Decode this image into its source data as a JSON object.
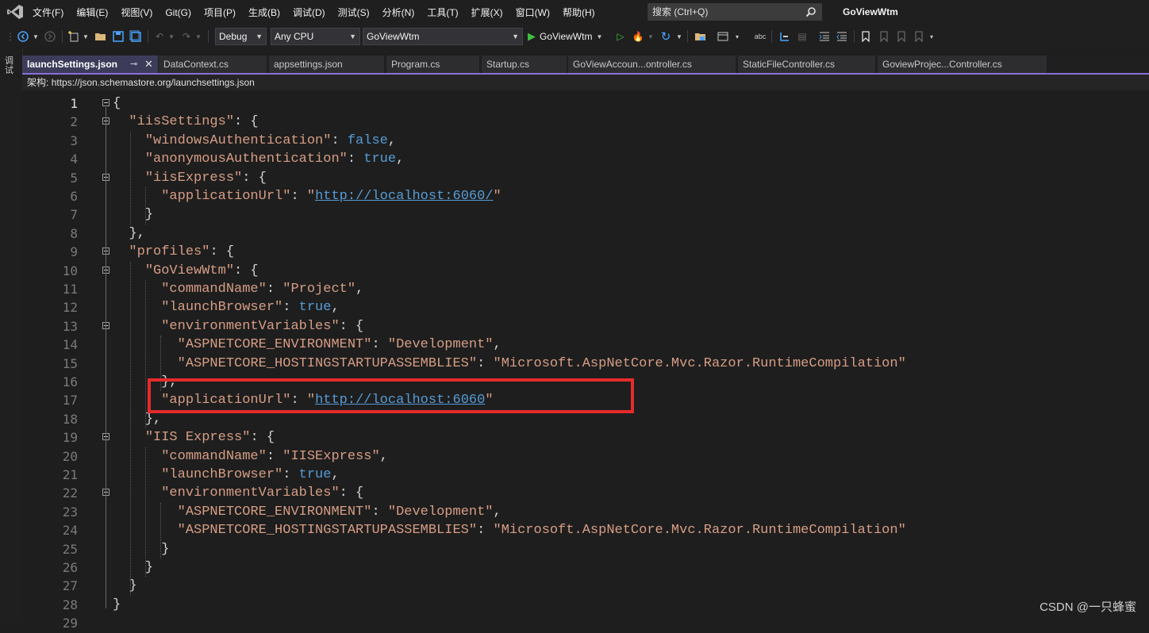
{
  "menu": [
    "文件(F)",
    "编辑(E)",
    "视图(V)",
    "Git(G)",
    "项目(P)",
    "生成(B)",
    "调试(D)",
    "测试(S)",
    "分析(N)",
    "工具(T)",
    "扩展(X)",
    "窗口(W)",
    "帮助(H)"
  ],
  "search": {
    "placeholder": "搜索 (Ctrl+Q)"
  },
  "app_title": "GoViewWtm",
  "toolbar": {
    "config": "Debug",
    "platform": "Any CPU",
    "project": "GoViewWtm",
    "run_label": "GoViewWtm"
  },
  "side_tab": "调试",
  "tabs": [
    {
      "label": "launchSettings.json",
      "active": true
    },
    {
      "label": "DataContext.cs"
    },
    {
      "label": "appsettings.json"
    },
    {
      "label": "Program.cs"
    },
    {
      "label": "Startup.cs"
    },
    {
      "label": "GoViewAccoun...ontroller.cs"
    },
    {
      "label": "StaticFileController.cs"
    },
    {
      "label": "GoviewProjec...Controller.cs"
    }
  ],
  "schema": {
    "label": "架构:",
    "url": "https://json.schemastore.org/launchsettings.json"
  },
  "lines": [
    {
      "n": "1",
      "text": "{"
    },
    {
      "n": "2",
      "text": "  \"iisSettings\": {"
    },
    {
      "n": "3",
      "text": "    \"windowsAuthentication\": false,"
    },
    {
      "n": "4",
      "text": "    \"anonymousAuthentication\": true,"
    },
    {
      "n": "5",
      "text": "    \"iisExpress\": {"
    },
    {
      "n": "6",
      "text": "      \"applicationUrl\": \"http://localhost:6060/\""
    },
    {
      "n": "7",
      "text": "    }"
    },
    {
      "n": "8",
      "text": "  },"
    },
    {
      "n": "9",
      "text": "  \"profiles\": {"
    },
    {
      "n": "10",
      "text": "    \"GoViewWtm\": {"
    },
    {
      "n": "11",
      "text": "      \"commandName\": \"Project\","
    },
    {
      "n": "12",
      "text": "      \"launchBrowser\": true,"
    },
    {
      "n": "13",
      "text": "      \"environmentVariables\": {"
    },
    {
      "n": "14",
      "text": "        \"ASPNETCORE_ENVIRONMENT\": \"Development\","
    },
    {
      "n": "15",
      "text": "        \"ASPNETCORE_HOSTINGSTARTUPASSEMBLIES\": \"Microsoft.AspNetCore.Mvc.Razor.RuntimeCompilation\""
    },
    {
      "n": "16",
      "text": "      },"
    },
    {
      "n": "17",
      "text": "      \"applicationUrl\": \"http://localhost:6060\""
    },
    {
      "n": "18",
      "text": "    },"
    },
    {
      "n": "19",
      "text": "    \"IIS Express\": {"
    },
    {
      "n": "20",
      "text": "      \"commandName\": \"IISExpress\","
    },
    {
      "n": "21",
      "text": "      \"launchBrowser\": true,"
    },
    {
      "n": "22",
      "text": "      \"environmentVariables\": {"
    },
    {
      "n": "23",
      "text": "        \"ASPNETCORE_ENVIRONMENT\": \"Development\","
    },
    {
      "n": "24",
      "text": "        \"ASPNETCORE_HOSTINGSTARTUPASSEMBLIES\": \"Microsoft.AspNetCore.Mvc.Razor.RuntimeCompilation\""
    },
    {
      "n": "25",
      "text": "      }"
    },
    {
      "n": "26",
      "text": "    }"
    },
    {
      "n": "27",
      "text": "  }"
    },
    {
      "n": "28",
      "text": "}"
    },
    {
      "n": "29",
      "text": ""
    }
  ],
  "watermark": "CSDN @一只蜂蜜",
  "colors": {
    "accent": "#8b6fd8",
    "highlight_box": "#e52b2b",
    "string": "#d69d85",
    "keyword": "#569cd6"
  }
}
